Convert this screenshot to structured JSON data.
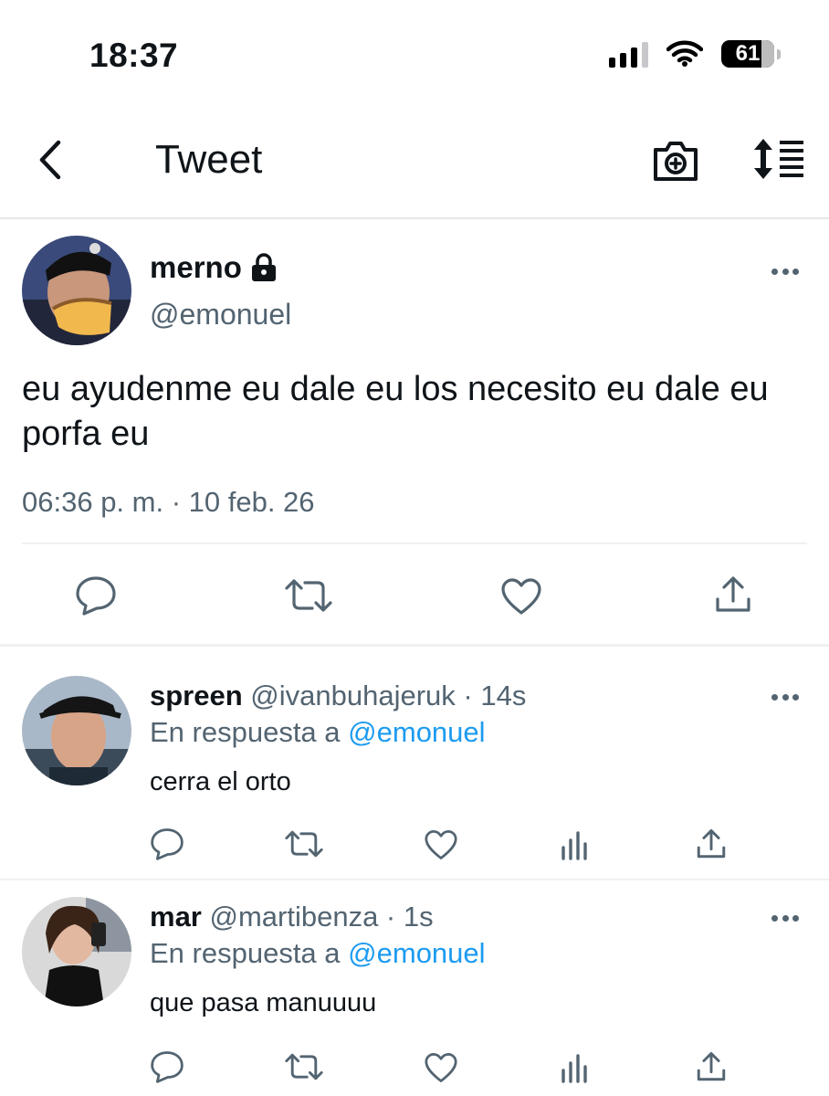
{
  "status_bar": {
    "time": "18:37",
    "battery": "61"
  },
  "nav": {
    "title": "Tweet"
  },
  "main_tweet": {
    "name": "merno",
    "handle": "@emonuel",
    "text": "eu ayudenme eu dale eu los necesito eu dale eu porfa eu",
    "timestamp": "06:36 p. m. · 10 feb. 26"
  },
  "replies": [
    {
      "name": "spreen",
      "meta": "@ivanbuhajeruk · 14s",
      "reply_prefix": "En respuesta a",
      "mention": "@emonuel",
      "text": "cerra el orto"
    },
    {
      "name": "mar",
      "meta": "@martibenza · 1s",
      "reply_prefix": "En respuesta a",
      "mention": "@emonuel",
      "text": "que pasa manuuuu"
    }
  ],
  "colors": {
    "muted": "#536471",
    "link": "#1d9bf0",
    "text": "#0f1419"
  }
}
